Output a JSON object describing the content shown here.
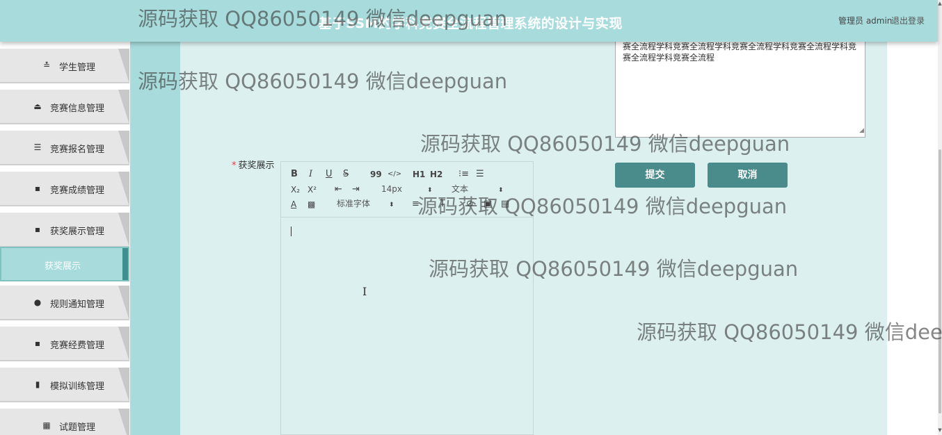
{
  "header": {
    "title": "基于SSM的学科竞赛全流程管理系统的设计与实现",
    "user": "管理员 admin",
    "logout": "退出登录"
  },
  "sidebar": {
    "items": [
      {
        "label": "学生管理",
        "icon": "sliders-icon"
      },
      {
        "label": "竞赛信息管理",
        "icon": "person-icon"
      },
      {
        "label": "竞赛报名管理",
        "icon": "list-icon"
      },
      {
        "label": "竞赛成绩管理",
        "icon": "grid-icon"
      },
      {
        "label": "获奖展示管理",
        "icon": "grid-icon"
      },
      {
        "label": "获奖展示",
        "active": true
      },
      {
        "label": "规则通知管理",
        "icon": "user-icon"
      },
      {
        "label": "竞赛经费管理",
        "icon": "grid-icon"
      },
      {
        "label": "模拟训练管理",
        "icon": "bar-chart-icon"
      },
      {
        "label": "试题管理",
        "icon": "grid-small-icon"
      }
    ]
  },
  "form": {
    "description_text": "赛全流程学科竞赛全流程学科竞赛全流程学科竞赛全流程学科竞赛全流程学科竞赛全流程",
    "award_label": "获奖展示",
    "required_mark": "*",
    "font_size": "14px",
    "paragraph_format": "文本",
    "font_family": "标准字体",
    "submit_label": "提交",
    "cancel_label": "取消"
  },
  "editor_toolbar": {
    "bold": "B",
    "italic": "I",
    "underline": "U",
    "strike": "S",
    "quote": "99",
    "code": "</>",
    "h1": "H1",
    "h2": "H2",
    "sub": "X₂",
    "sup": "X²"
  },
  "watermarks": [
    "源码获取 QQ86050149 微信deepguan",
    "源码获取 QQ86050149 微信deepguan",
    "源码获取 QQ86050149 微信deepguan",
    "源码获取 QQ86050149 微信deepguan",
    "源码获取 QQ86050149 微信deepguan",
    "源码获取 QQ86050149 微信dee"
  ],
  "colors": {
    "header_bg": "#a8dcdc",
    "content_bg": "#dcf0f0",
    "button_bg": "#4a8c8c",
    "active_menu_bg": "#a8dcdc"
  }
}
